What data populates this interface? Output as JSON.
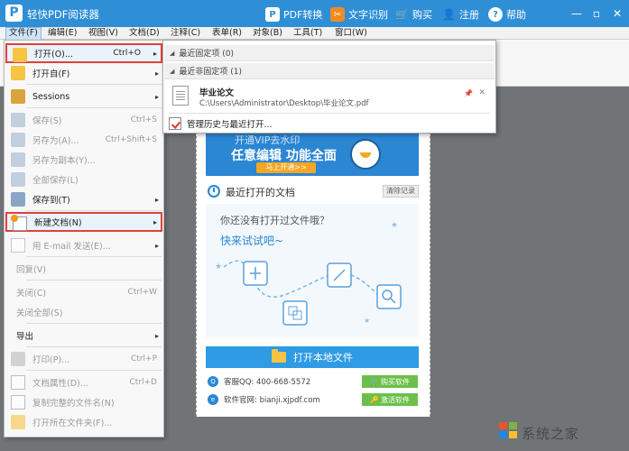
{
  "titlebar": {
    "app_title": "轻快PDF阅读器",
    "logo_letter": "P",
    "pdf_convert": "PDF转换",
    "ocr": "文字识别",
    "buy": "购买",
    "register": "注册",
    "help": "帮助"
  },
  "menubar": [
    "文件(F)",
    "编辑(E)",
    "视图(V)",
    "文档(D)",
    "注释(C)",
    "表单(R)",
    "对象(B)",
    "工具(T)",
    "窗口(W)"
  ],
  "file_menu": {
    "open": {
      "label": "打开(O)...",
      "shortcut": "Ctrl+O"
    },
    "open_from": "打开自(F)",
    "sessions": "Sessions",
    "save": {
      "label": "保存(S)",
      "shortcut": "Ctrl+S"
    },
    "save_as": {
      "label": "另存为(A)...",
      "shortcut": "Ctrl+Shift+S"
    },
    "save_copy": "另存为副本(Y)...",
    "save_all": "全部保存(L)",
    "save_to": "保存到(T)",
    "new_doc": "新建文档(N)",
    "email": "用 E-mail 发送(E)...",
    "revert": "回复(V)",
    "close": {
      "label": "关闭(C)",
      "shortcut": "Ctrl+W"
    },
    "close_all": "关闭全部(S)",
    "export": "导出",
    "print": {
      "label": "打印(P)...",
      "shortcut": "Ctrl+P"
    },
    "properties": {
      "label": "文档属性(D)...",
      "shortcut": "Ctrl+D"
    },
    "copy_name": "复制完整的文件名(N)",
    "open_folder": "打开所在文件夹(F)..."
  },
  "submenu": {
    "pinned_header": "最近固定项 (0)",
    "unpinned_header": "最近非固定项 (1)",
    "recent_file": {
      "name": "毕业论文",
      "path": "C:\\Users\\Administrator\\Desktop\\毕业论文.pdf"
    },
    "manage": "管理历史与最近打开..."
  },
  "start_page": {
    "promo_line1": "开通VIP去水印",
    "promo_line2": "任意编辑  功能全面",
    "promo_button": "马上开通>>",
    "recent_title": "最近打开的文档",
    "clear_records": "清除记录",
    "empty_question": "你还没有打开过文件哦？",
    "try_now": "快来试试吧~",
    "open_local": "打开本地文件",
    "qq": "客服QQ: 400-668-5572",
    "site": "软件官网: bianji.xjpdf.com",
    "buy_software": "购买软件",
    "activate_software": "激活软件"
  },
  "watermark": "系统之家",
  "colors": {
    "titlebar": "#2f8fd6",
    "accent": "#2b86d4",
    "highlight_border": "#e0413a",
    "green": "#6cc04a"
  }
}
